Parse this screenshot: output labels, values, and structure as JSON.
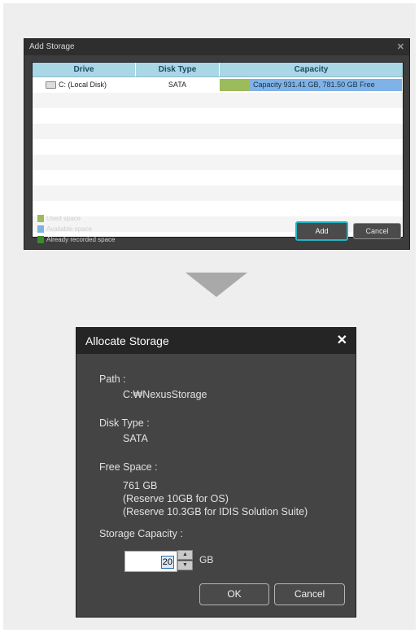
{
  "add_storage": {
    "title": "Add Storage",
    "close_glyph": "✕",
    "columns": [
      "Drive",
      "Disk Type",
      "Capacity"
    ],
    "rows": [
      {
        "drive": "C: (Local Disk)",
        "disk_type": "SATA",
        "capacity": "Capacity 931.41 GB, 781.50 GB Free",
        "used_fraction": 0.16
      }
    ],
    "legend": [
      {
        "label": "Used space",
        "color": "#9cbb5a"
      },
      {
        "label": "Available space",
        "color": "#7fb2e6"
      },
      {
        "label": "Already recorded space",
        "color": "#3f8a2c"
      }
    ],
    "add_label": "Add",
    "cancel_label": "Cancel"
  },
  "allocate_storage": {
    "title": "Allocate Storage",
    "close_glyph": "✕",
    "path_label": "Path :",
    "path_value": "C:₩NexusStorage",
    "disk_type_label": "Disk Type :",
    "disk_type_value": "SATA",
    "free_space_label": "Free Space :",
    "free_space_value": "761 GB",
    "reserve_os": "(Reserve 10GB for OS)",
    "reserve_suite": "(Reserve 10.3GB for IDIS Solution Suite)",
    "capacity_label": "Storage Capacity :",
    "capacity_value": "20",
    "capacity_unit": "GB",
    "ok_label": "OK",
    "cancel_label": "Cancel"
  },
  "colors": {
    "accent_focus": "#1fb6c6",
    "header_blue": "#a9d7e5"
  }
}
